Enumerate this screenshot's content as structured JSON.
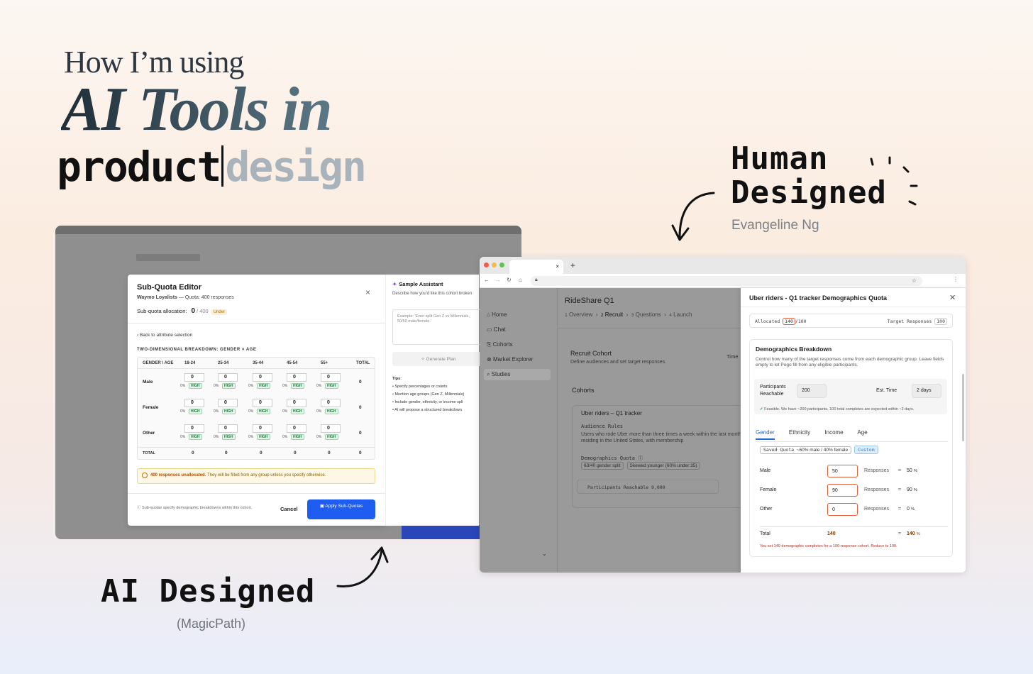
{
  "headline": {
    "line1": "How I’m using",
    "line2": "AI Tools in",
    "line3_dark": "product",
    "line3_light": "design"
  },
  "human_label": {
    "line1": "Human",
    "line2": "Designed",
    "author": "Evangeline Ng"
  },
  "ai_label": {
    "title": "AI Designed",
    "source": "(MagicPath)"
  },
  "ai_window": {
    "editor": {
      "title": "Sub-Quota Editor",
      "cohort": "Waymo Loyalists",
      "quota_text": "— Quota: 400 responses",
      "alloc_label": "Sub-quota allocation:",
      "alloc_value": "0",
      "alloc_total": "/ 400",
      "alloc_status": "Under",
      "close": "×",
      "back_link": "‹ Back to attribute selection",
      "breakdown_title": "TWO-DIMENSIONAL BREAKDOWN: GENDER × AGE",
      "columns": [
        "GENDER \\ AGE",
        "18-24",
        "25-34",
        "35-44",
        "45-54",
        "55+",
        "TOTAL"
      ],
      "rows": [
        {
          "label": "Male",
          "cells": [
            "0",
            "0",
            "0",
            "0",
            "0"
          ],
          "total": "0"
        },
        {
          "label": "Female",
          "cells": [
            "0",
            "0",
            "0",
            "0",
            "0"
          ],
          "total": "0"
        },
        {
          "label": "Other",
          "cells": [
            "0",
            "0",
            "0",
            "0",
            "0"
          ],
          "total": "0"
        }
      ],
      "cell_pct": "0%",
      "cell_badge": "HIGH",
      "total_row": {
        "label": "TOTAL",
        "values": [
          "0",
          "0",
          "0",
          "0",
          "0",
          "0"
        ]
      },
      "warning_bold": "400 responses unallocated.",
      "warning_text": "They will be filled from any group unless you specify otherwise.",
      "footer_note": "Sub-quotas specify demographic breakdowns within this cohort.",
      "cancel_label": "Cancel",
      "apply_label": "Apply Sub-Quotas"
    },
    "assistant": {
      "title": "Sample Assistant",
      "description": "Describe how you'd like this cohort broken",
      "placeholder": "Example: 'Even split Gen Z vs Millennials, 50/50 male/female.'",
      "generate_label": "Generate Plan",
      "tips_title": "Tips:",
      "tips": [
        "Specify percentages or counts",
        "Mention age groups (Gen Z, Millennials)",
        "Include gender, ethnicity, or income spli",
        "AI will propose a structured breakdown"
      ]
    }
  },
  "human_window": {
    "tab_close": "×",
    "new_tab": "+",
    "nav_icons": [
      "←",
      "→",
      "↻",
      "⌂"
    ],
    "sidebar": [
      "Home",
      "Chat",
      "Cohorts",
      "Market Explorer",
      "Studies"
    ],
    "sidebar_icons": [
      "⌂",
      "▭",
      "⎘",
      "⊗",
      "⌕"
    ],
    "project_title": "RideShare Q1",
    "steps": [
      {
        "num": "1",
        "label": "Overview"
      },
      {
        "num": "2",
        "label": "Recruit"
      },
      {
        "num": "3",
        "label": "Questions"
      },
      {
        "num": "4",
        "label": "Launch"
      }
    ],
    "recruit_title": "Recruit Cohort",
    "recruit_desc": "Define audiences and set target responses.",
    "time_label": "Time",
    "cohorts_title": "Cohorts",
    "cohort_card": {
      "name": "Uber riders – Q1 tracker",
      "rules_title": "Audience Rules",
      "rules_text": "Users who rode Uber more than three times a week within the last month, residing in the United States, with membership",
      "quota_title": "Demographics Quota",
      "chips": [
        "60/40 gender split",
        "Skewed younger (60% under 35)"
      ],
      "reach_label": "Participants Reachable",
      "reach_value": "9,000"
    },
    "panel": {
      "title": "Uber riders - Q1 tracker Demographics Quota",
      "allocated_label": "Allocated",
      "allocated_value": "140",
      "allocated_total": "/100",
      "target_label": "Target Responses",
      "target_value": "100",
      "breakdown_title": "Demographics Breakdown",
      "breakdown_desc": "Control how many of the target responses come from each demographic group. Leave fields empty to let Pogo fill from any eligible participants.",
      "reach_label": "Participants Reachable",
      "reach_value": "200",
      "est_label": "Est. Time",
      "est_value": "2 days",
      "feasible": "Feasible. We have ~200 participants, 100 total completes are expected within ~2 days.",
      "tabs": [
        "Gender",
        "Ethnicity",
        "Income",
        "Age"
      ],
      "saved_quota": "Saved Quota",
      "saved_quota_value": "~60% male / 40% female",
      "custom": "Custom",
      "rows": [
        {
          "label": "Male",
          "value": "50",
          "unit": "Responses",
          "pct": "50"
        },
        {
          "label": "Female",
          "value": "90",
          "unit": "Responses",
          "pct": "90"
        },
        {
          "label": "Other",
          "value": "0",
          "unit": "Responses",
          "pct": "0"
        }
      ],
      "total_label": "Total",
      "total_value": "140",
      "total_pct": "140",
      "error": "You set 140 demographic completes for a 100-response cohort. Reduce to 100."
    }
  }
}
